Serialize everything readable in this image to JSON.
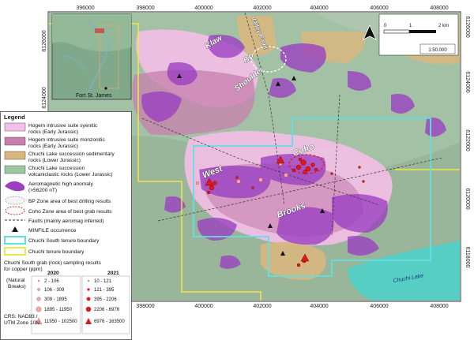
{
  "grid": {
    "easting_labels": [
      "396000",
      "398000",
      "400000",
      "402000",
      "404000",
      "406000",
      "408000"
    ],
    "northing_labels": [
      "6126000",
      "6124000",
      "6122000",
      "6120000",
      "6118000"
    ]
  },
  "place_labels": {
    "klaw": "Klaw",
    "bp": "BP",
    "valley_fault": "Valley Fault",
    "shoulder": "Shoulder",
    "coho": "Coho",
    "west": "West",
    "brooks": "Brooks",
    "chuchi_lake": "Chuchi Lake"
  },
  "inset": {
    "town": "Fort St. James"
  },
  "scale_bar": {
    "start": "0",
    "mid": "1",
    "end": "2 km",
    "ratio": "1:50,000"
  },
  "north_arrow": {
    "icon": "north-arrow-icon"
  },
  "legend": {
    "title": "Legend",
    "items": [
      {
        "line1": "Hogem intrusive suite syenitic",
        "line2": "rocks (Early Jurassic)",
        "color": "#f4bfe8"
      },
      {
        "line1": "Hogem intrusive suite monzonitic",
        "line2": "rocks (Early Jurassic)",
        "color": "#c77fae"
      },
      {
        "line1": "Chuchi Lake succession sedimentary",
        "line2": "rocks (Lower Jurassic)",
        "color": "#d9b77f"
      },
      {
        "line1": "Chuchi Lake succession",
        "line2": "volcaniclastic rocks (Lower Jurassic)",
        "color": "#9fc6a3"
      }
    ],
    "aeromag": {
      "line1": "Aeromagnetic high anomaly",
      "line2": "(>56200 nT)",
      "color": "#9b3fc2"
    },
    "bp_zone": "BP Zone area of best drilling results",
    "coho_zone": "Coho Zone area of best grab results",
    "faults": "Faults (mainly aeromag inferred)",
    "minfile": "MINFILE occurrence",
    "chuchi_south": {
      "label": "Chuchi South tenure boundary",
      "color": "#5fe0e6"
    },
    "chuchi": {
      "label": "Chuchi tenure boundary",
      "color": "#f2e64a"
    },
    "grab_title_1": "Chuchi South grab (rock) sampling results",
    "grab_title_2": "for copper (ppm)",
    "natural_1": "(Natural",
    "natural_2": "Breaks)",
    "year_2020": "2020",
    "year_2021": "2021",
    "classes_2020": [
      "2 - 106",
      "106 - 309",
      "309 - 1895",
      "1895 - 11950",
      "11950 - 102500"
    ],
    "classes_2021": [
      "10 - 121",
      "121 - 395",
      "395 - 2206",
      "2206 - 6976",
      "6976 - 163500"
    ],
    "crs_1": "CRS: NAD83 /",
    "crs_2": "UTM Zone 10N"
  }
}
